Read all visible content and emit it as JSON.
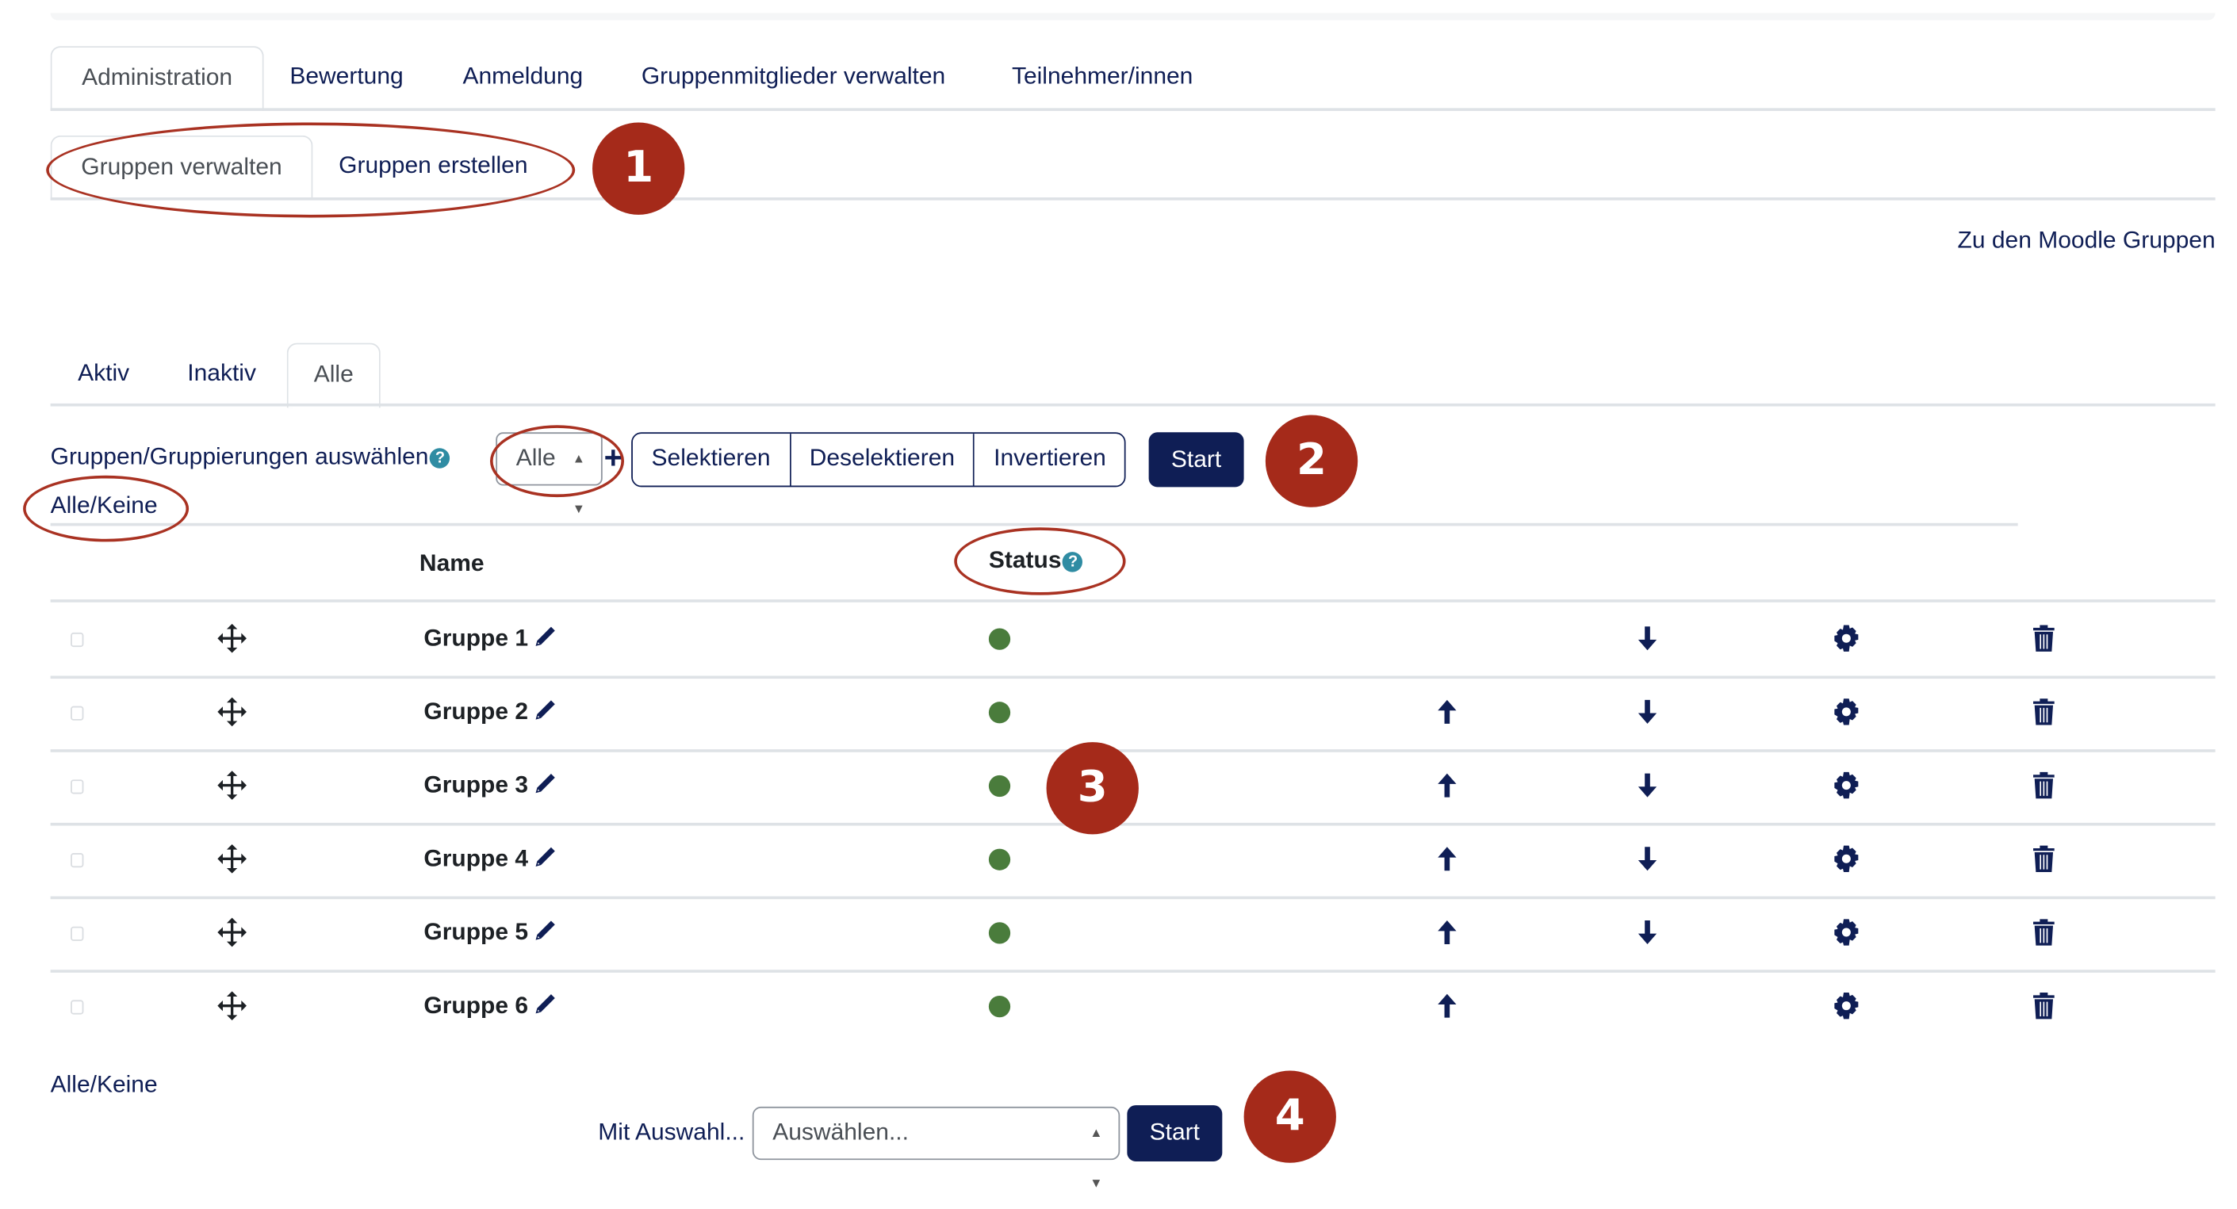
{
  "main_tabs": [
    {
      "label": "Administration",
      "active": true
    },
    {
      "label": "Bewertung",
      "active": false
    },
    {
      "label": "Anmeldung",
      "active": false
    },
    {
      "label": "Gruppenmitglieder verwalten",
      "active": false
    },
    {
      "label": "Teilnehmer/innen",
      "active": false
    }
  ],
  "sub_tabs": [
    {
      "label": "Gruppen verwalten",
      "active": true
    },
    {
      "label": "Gruppen erstellen",
      "active": false
    }
  ],
  "moodle_groups_link": "Zu den Moodle Gruppen",
  "filter_tabs": [
    {
      "label": "Aktiv",
      "active": false
    },
    {
      "label": "Inaktiv",
      "active": false
    },
    {
      "label": "Alle",
      "active": true
    }
  ],
  "selection": {
    "label": "Gruppen/Gruppierungen auswählen",
    "help_icon": "question-circle-icon",
    "select_value": "Alle",
    "add_icon": "plus-icon",
    "buttons": [
      "Selektieren",
      "Deselektieren",
      "Invertieren"
    ],
    "start_label": "Start",
    "all_none_link": "Alle/Keine"
  },
  "table": {
    "headers": {
      "name": "Name",
      "status": "Status"
    },
    "status_help_icon": "question-circle-icon",
    "rows": [
      {
        "name": "Gruppe 1",
        "status": "active",
        "checked": false,
        "move_up": false,
        "move_down": true
      },
      {
        "name": "Gruppe 2",
        "status": "active",
        "checked": false,
        "move_up": true,
        "move_down": true
      },
      {
        "name": "Gruppe 3",
        "status": "active",
        "checked": false,
        "move_up": true,
        "move_down": true
      },
      {
        "name": "Gruppe 4",
        "status": "active",
        "checked": false,
        "move_up": true,
        "move_down": true
      },
      {
        "name": "Gruppe 5",
        "status": "active",
        "checked": false,
        "move_up": true,
        "move_down": true
      },
      {
        "name": "Gruppe 6",
        "status": "active",
        "checked": false,
        "move_up": true,
        "move_down": false
      }
    ],
    "row_icons": [
      "move-icon",
      "edit-pencil-icon",
      "status-dot",
      "arrow-up-icon",
      "arrow-down-icon",
      "gear-icon",
      "trash-icon"
    ]
  },
  "bottom": {
    "all_none_link": "Alle/Keine",
    "with_selection_label": "Mit Auswahl...",
    "select_placeholder": "Auswählen...",
    "start_label": "Start"
  },
  "annotations": {
    "badges": [
      "1",
      "2",
      "3",
      "4"
    ]
  },
  "colors": {
    "primary": "#0f1e55",
    "status_active": "#4a7c3c",
    "help_icon": "#2f8ca3",
    "annotation": "#a52a1a",
    "divider": "#dee2e6"
  }
}
